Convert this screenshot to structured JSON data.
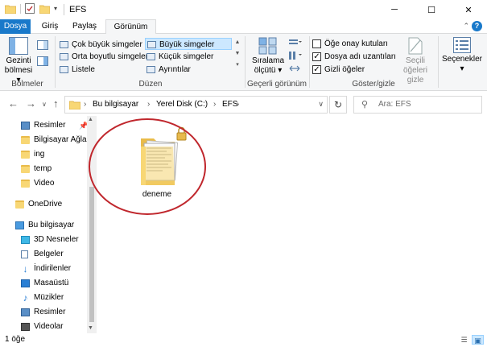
{
  "window": {
    "title": "EFS",
    "minimize_glyph": "─",
    "maximize_glyph": "☐",
    "close_glyph": "✕"
  },
  "ribbon_tabs": {
    "file": "Dosya",
    "home": "Giriş",
    "share": "Paylaş",
    "view": "Görünüm",
    "help_glyph": "?"
  },
  "panes_group": {
    "nav_pane_label_line1": "Gezinti",
    "nav_pane_label_line2": "bölmesi",
    "group_label": "Bölmeler"
  },
  "layout_group": {
    "items": [
      "Çok büyük simgeler",
      "Büyük simgeler",
      "Orta boyutlu simgeler",
      "Küçük simgeler",
      "Listele",
      "Ayrıntılar"
    ],
    "selected": "Büyük simgeler",
    "group_label": "Düzen"
  },
  "current_view_group": {
    "sort_label_line1": "Sıralama",
    "sort_label_line2": "ölçütü",
    "group_label": "Geçerli görünüm"
  },
  "show_hide_group": {
    "checkboxes": [
      {
        "label": "Öğe onay kutuları",
        "checked": false
      },
      {
        "label": "Dosya adı uzantıları",
        "checked": true
      },
      {
        "label": "Gizli öğeler",
        "checked": true
      }
    ],
    "hide_selected_line1": "Seçili öğeleri",
    "hide_selected_line2": "gizle",
    "group_label": "Göster/gizle"
  },
  "options": {
    "label": "Seçenekler"
  },
  "address_bar": {
    "segments": [
      "Bu bilgisayar",
      "Yerel Disk (C:)",
      "EFS"
    ],
    "search_placeholder": "Ara: EFS"
  },
  "nav_pane": {
    "quick_access": [
      {
        "label": "Resimler",
        "icon": "pictures-icon",
        "pinned": true
      },
      {
        "label": "Bilgisayar Ağlara",
        "icon": "folder-icon"
      },
      {
        "label": "ing",
        "icon": "folder-icon"
      },
      {
        "label": "temp",
        "icon": "folder-icon"
      },
      {
        "label": "Video",
        "icon": "folder-icon"
      }
    ],
    "onedrive": "OneDrive",
    "this_pc": "Bu bilgisayar",
    "this_pc_children": [
      {
        "label": "3D Nesneler",
        "icon": "3d-objects-icon"
      },
      {
        "label": "Belgeler",
        "icon": "documents-icon"
      },
      {
        "label": "İndirilenler",
        "icon": "downloads-icon"
      },
      {
        "label": "Masaüstü",
        "icon": "desktop-icon"
      },
      {
        "label": "Müzikler",
        "icon": "music-icon"
      },
      {
        "label": "Resimler",
        "icon": "pictures-icon"
      },
      {
        "label": "Videolar",
        "icon": "videos-icon"
      }
    ]
  },
  "content": {
    "items": [
      {
        "name": "deneme",
        "type": "folder",
        "encrypted": true
      }
    ],
    "highlight_color": "#c0272d"
  },
  "status_bar": {
    "item_count": "1 öğe"
  },
  "colors": {
    "accent": "#1979ca",
    "folder": "#f8d775",
    "ribbon_bg": "#f5f6f7",
    "selection": "#cce8ff"
  }
}
